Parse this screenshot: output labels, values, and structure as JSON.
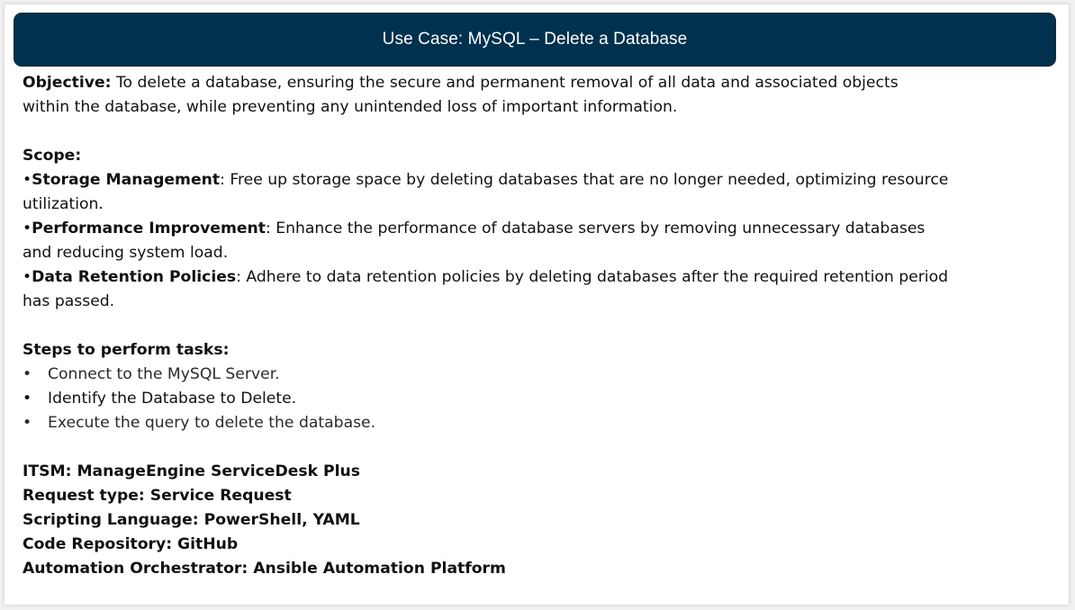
{
  "title": "Use Case: MySQL – Delete a Database",
  "objective": {
    "label": "Objective:",
    "line1": " To delete a database, ensuring the secure and permanent removal of all data and associated objects",
    "line2": "within the database, while preventing any unintended loss of important information."
  },
  "scope": {
    "heading": "Scope:",
    "items": [
      {
        "bullet": "•",
        "label": "Storage Management",
        "line1": ": Free up storage space by deleting databases that are no longer needed, optimizing resource",
        "line2": "utilization."
      },
      {
        "bullet": "•",
        "label": "Performance Improvement",
        "line1": ": Enhance the performance of database servers by removing unnecessary databases",
        "line2": "and reducing system load."
      },
      {
        "bullet": "•",
        "label": "Data Retention Policies",
        "line1": ": Adhere to data retention policies by deleting databases after the required retention period",
        "line2": "has passed."
      }
    ]
  },
  "steps": {
    "heading": "Steps to perform tasks:",
    "bullet": "•",
    "items": [
      "Connect to the MySQL Server.",
      "Identify the Database to Delete.",
      "Execute the query to delete the database."
    ]
  },
  "details": [
    "ITSM: ManageEngine ServiceDesk Plus",
    "Request type: Service Request",
    "Scripting Language: PowerShell, YAML",
    "Code Repository: GitHub",
    "Automation Orchestrator: Ansible Automation Platform"
  ],
  "colors": {
    "title_bar": "#00314f",
    "title_text": "#ffffff",
    "body_text": "#111111"
  }
}
